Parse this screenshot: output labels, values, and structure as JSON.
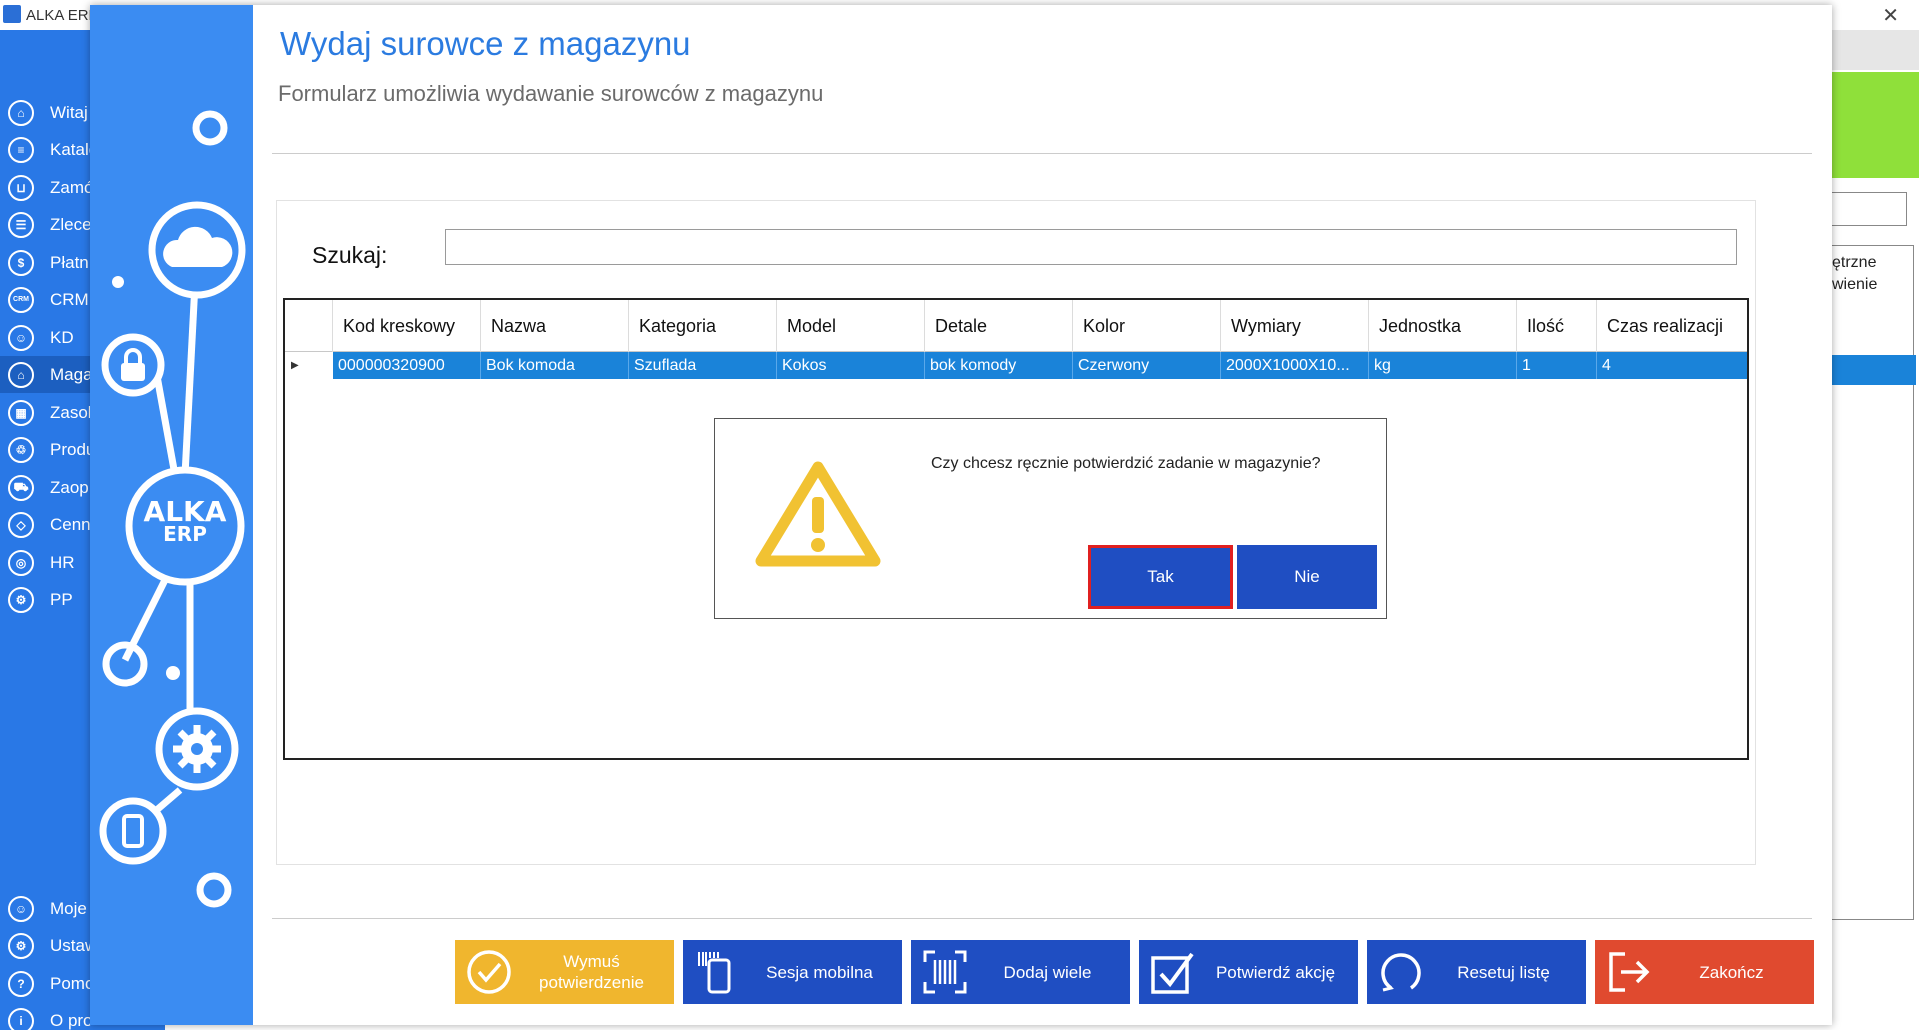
{
  "app": {
    "title": "ALKA ERP"
  },
  "sidebar": {
    "items": [
      {
        "label": "Witaj",
        "icon": "home-icon"
      },
      {
        "label": "Katalo",
        "icon": "catalog-icon"
      },
      {
        "label": "Zamó",
        "icon": "cart-icon"
      },
      {
        "label": "Zlece",
        "icon": "list-icon"
      },
      {
        "label": "Płatn",
        "icon": "dollar-icon"
      },
      {
        "label": "CRM",
        "icon": "crm-icon"
      },
      {
        "label": "KD",
        "icon": "user-icon"
      },
      {
        "label": "Maga",
        "icon": "warehouse-icon"
      },
      {
        "label": "Zasob",
        "icon": "resources-icon"
      },
      {
        "label": "Produ",
        "icon": "production-icon"
      },
      {
        "label": "Zaop",
        "icon": "truck-icon"
      },
      {
        "label": "Cenn",
        "icon": "tag-icon"
      },
      {
        "label": "HR",
        "icon": "hr-icon"
      },
      {
        "label": "PP",
        "icon": "pp-icon"
      }
    ],
    "bottom_items": [
      {
        "label": "Moje",
        "icon": "account-icon"
      },
      {
        "label": "Ustaw",
        "icon": "settings-icon"
      },
      {
        "label": "Pomo",
        "icon": "help-icon"
      },
      {
        "label": "O pro",
        "icon": "info-icon"
      }
    ]
  },
  "background": {
    "right_header_line1": "ętrzne",
    "right_header_line2": "wienie"
  },
  "window": {
    "title": "Wydaj surowce z magazynu",
    "subtitle": "Formularz umożliwia wydawanie surowców z magazynu",
    "logo_line1": "ALKA",
    "logo_line2": "ERP"
  },
  "search": {
    "label": "Szukaj:",
    "value": ""
  },
  "table": {
    "columns": [
      "Kod kreskowy",
      "Nazwa",
      "Kategoria",
      "Model",
      "Detale",
      "Kolor",
      "Wymiary",
      "Jednostka",
      "Ilość",
      "Czas realizacji"
    ],
    "rows": [
      [
        "000000320900",
        "Bok komoda",
        "Szuflada",
        "Kokos",
        "bok komody",
        "Czerwony",
        "2000X1000X10...",
        "kg",
        "1",
        "4"
      ]
    ]
  },
  "dialog": {
    "message": "Czy chcesz ręcznie potwierdzić zadanie w magazynie?",
    "yes": "Tak",
    "no": "Nie",
    "icon": "warning-icon"
  },
  "actions": [
    {
      "label": "Wymuś potwierdzenie",
      "icon": "check-circle-icon",
      "color": "#f0b62e"
    },
    {
      "label": "Sesja mobilna",
      "icon": "mobile-barcode-icon",
      "color": "#1f4ec2"
    },
    {
      "label": "Dodaj wiele",
      "icon": "barcode-scan-icon",
      "color": "#1f4ec2"
    },
    {
      "label": "Potwierdź akcję",
      "icon": "checkbox-icon",
      "color": "#1f4ec2"
    },
    {
      "label": "Resetuj listę",
      "icon": "refresh-icon",
      "color": "#1f4ec2"
    },
    {
      "label": "Zakończ",
      "icon": "exit-icon",
      "color": "#e04a2f"
    }
  ]
}
